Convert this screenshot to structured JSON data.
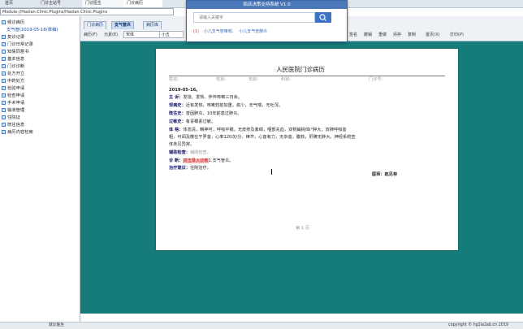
{
  "window_tabs": [
    "首页",
    "门诊主站号",
    "门诊医生",
    "门诊病历"
  ],
  "address": "Module://Haolan.Clinic.Plugins/Haolan.Clinic.Plugins",
  "sidebar": {
    "items": [
      {
        "label": "候诊病历",
        "sub": false
      },
      {
        "label": "支气管(2019-05-16(草稿)",
        "sub": true
      },
      {
        "label": "复诊记录",
        "sub": false
      },
      {
        "label": "门诊日常记录",
        "sub": false
      },
      {
        "label": "知情同意书",
        "sub": false
      },
      {
        "label": "基本信息",
        "sub": false
      },
      {
        "label": "门诊诊断",
        "sub": false
      },
      {
        "label": "处方开立",
        "sub": false
      },
      {
        "label": "中药处方",
        "sub": false
      },
      {
        "label": "检验申请",
        "sub": false
      },
      {
        "label": "检查申请",
        "sub": false
      },
      {
        "label": "手术申请",
        "sub": false
      },
      {
        "label": "输液管理",
        "sub": false
      },
      {
        "label": "住院证",
        "sub": false
      },
      {
        "label": "既往信息",
        "sub": false
      },
      {
        "label": "病历内容检索",
        "sub": false
      }
    ]
  },
  "toolbar": {
    "tabs": [
      "病历(F)",
      "元素(E)",
      "门诊病历",
      "支气管炎",
      "病历库"
    ],
    "font_select": "宋体",
    "size_select": "小五",
    "right_buttons": [
      "签名",
      "撤销",
      "重做",
      "另存",
      "复制",
      "首页(X)",
      "打印(P)"
    ]
  },
  "popup": {
    "title": "临床决策支持系统 V1.0",
    "placeholder": "请输入关键字",
    "links": [
      "(1)",
      "小儿支气管哮喘、",
      "小儿支气管肺炎"
    ]
  },
  "document": {
    "hospital_title": "人民医院门诊病历",
    "header_fields": [
      "姓名：",
      "性别：",
      "年龄：",
      "科别：",
      "门诊号："
    ],
    "date": "2019-05-16。",
    "chief_complaint_label": "主  诉：",
    "chief_complaint": "发烧、发热、伴伴咳嗽三日余。",
    "present_label": "现病史：",
    "present": "近有发热，咳嗽较前加重，痰少，无气喘，无吐泻。",
    "past_label": "既往史：",
    "past": "曾因肺炎，10年前患过肺炎。",
    "allergy_label": "过敏史：",
    "allergy": "有青霉素过敏。",
    "exam_label": "体  格：",
    "exam_lines": [
      "体态清，精神可，呼吸平稳，无皮疹及紫绀，咽部充血，双侧扁桃体Ⅰ°肿大，双肺呼吸音",
      "粗，可闻及散在干罗音，心率120次/分，律齐，心音有力，无杂音，腹软，肝脾无肿大，神经系统查",
      "体未见异常。"
    ],
    "aux_label": "辅助检查：",
    "aux": "辅助检查。",
    "diag_label": "诊  断：",
    "diag_highlight": "双击录入诊断",
    "diag_rest": "1.支气管炎。",
    "treat_label": "治疗建议：",
    "treat": "住院治疗。",
    "doctor": "医师：赵见林",
    "page_label": "第 1 页"
  },
  "status": {
    "left": "就诊医生",
    "right": "copyright © hg2la2ab.cn 2019"
  }
}
